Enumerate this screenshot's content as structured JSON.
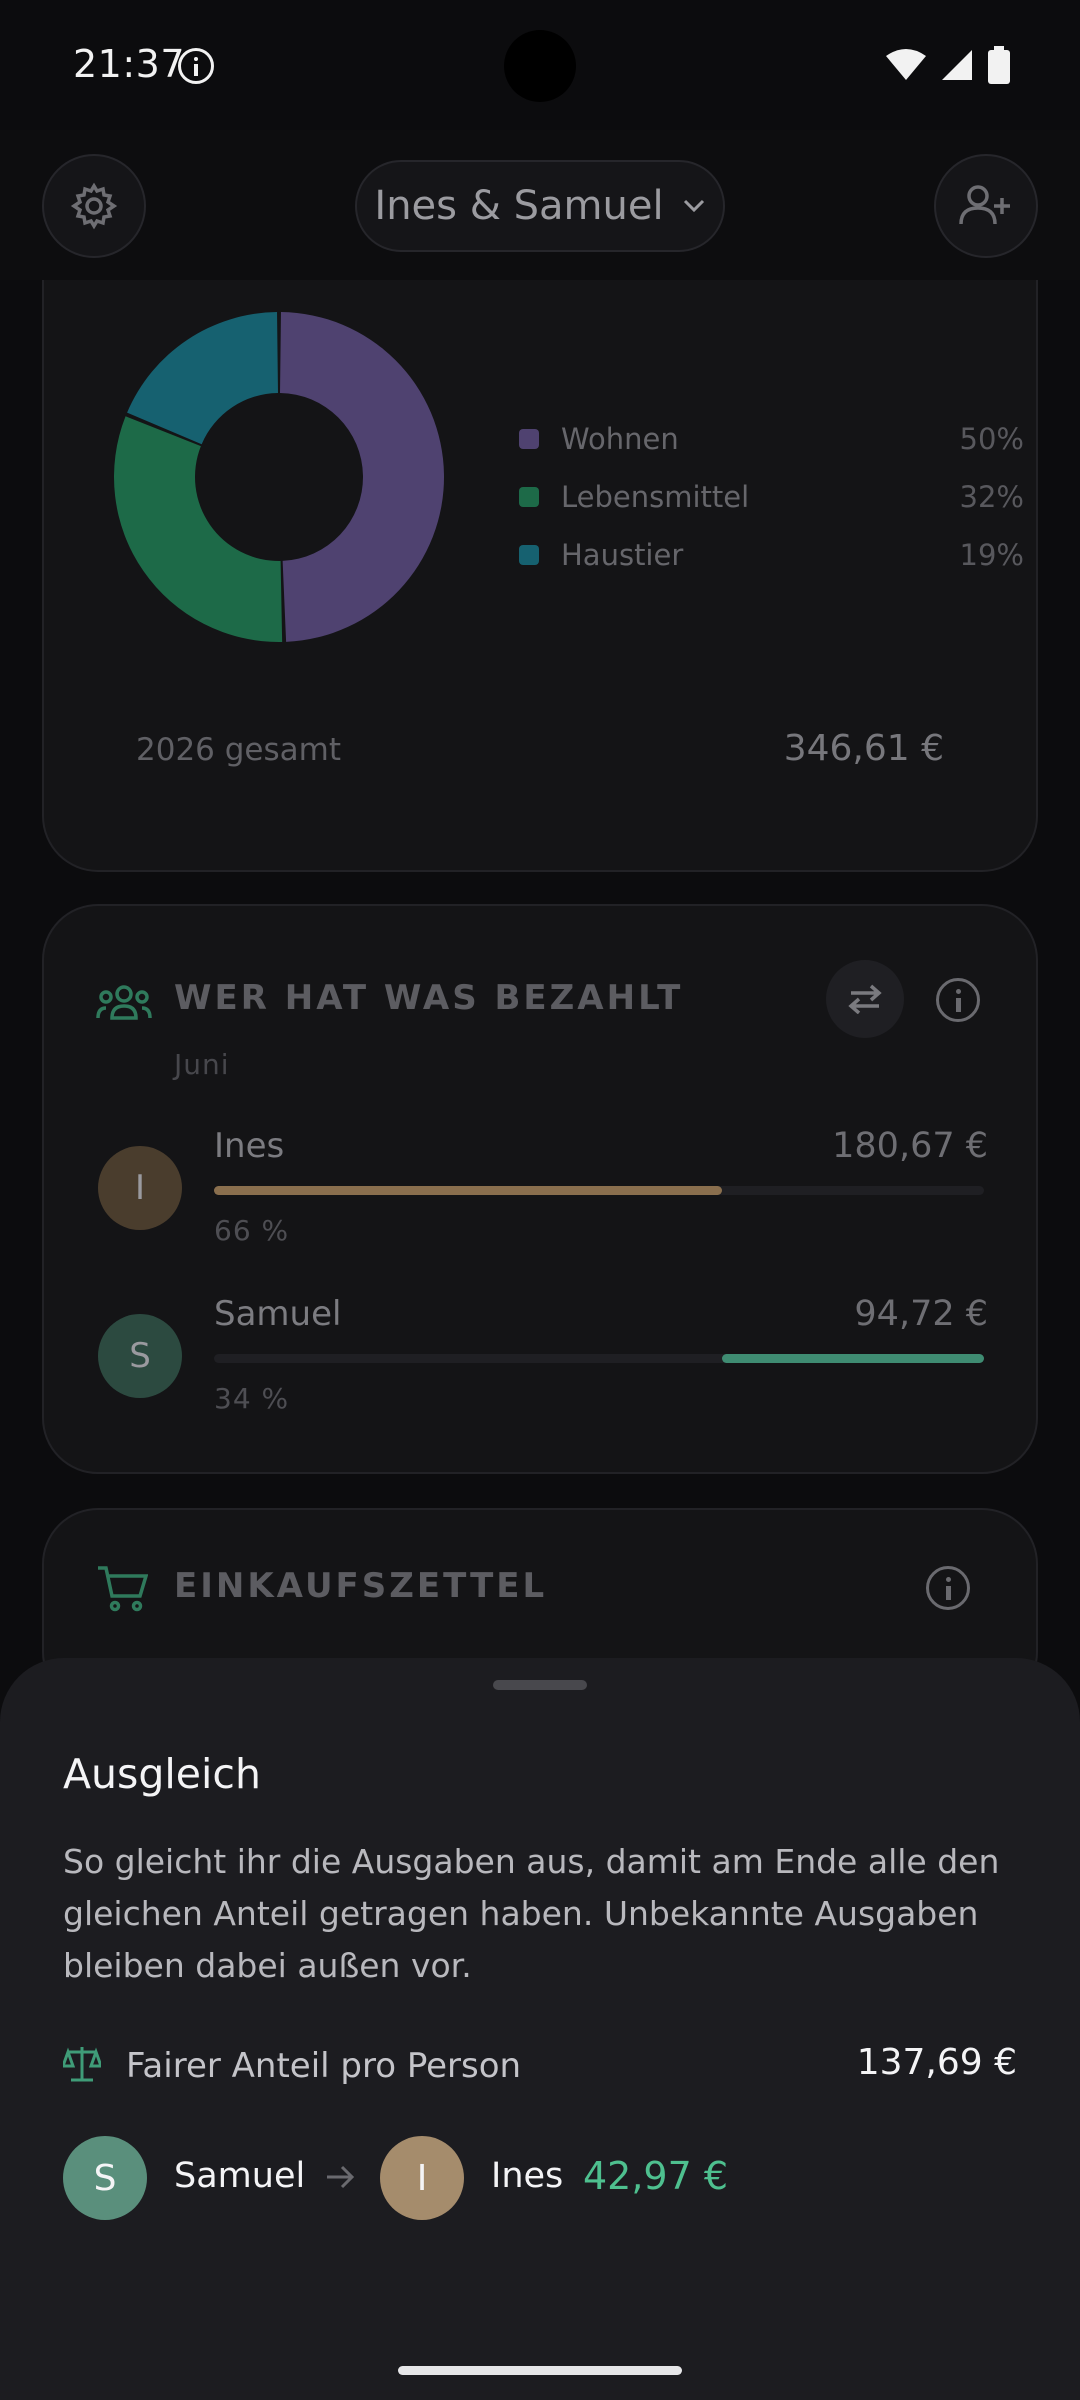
{
  "status_bar": {
    "time": "21:37"
  },
  "header": {
    "group_name": "Ines & Samuel"
  },
  "chart_card": {
    "total_label": "2026 gesamt",
    "total_value": "346,61 €"
  },
  "chart_data": {
    "type": "pie",
    "categories": [
      "Wohnen",
      "Lebensmittel",
      "Haustier"
    ],
    "values": [
      50,
      32,
      19
    ],
    "labels": [
      "50%",
      "32%",
      "19%"
    ],
    "colors": [
      "#4f4270",
      "#1d6a48",
      "#166170"
    ]
  },
  "paid_card": {
    "title": "WER HAT WAS BEZAHLT",
    "period": "Juni",
    "people": [
      {
        "initial": "I",
        "name": "Ines",
        "amount": "180,67 €",
        "percent_label": "66 %",
        "share": 0.66,
        "color": "#8a6f4e",
        "avatar_bg": "#4a3d2d"
      },
      {
        "initial": "S",
        "name": "Samuel",
        "amount": "94,72 €",
        "percent_label": "34 %",
        "share": 0.34,
        "color": "#3f8c72",
        "avatar_bg": "#2c4a40"
      }
    ]
  },
  "shopping_card": {
    "title": "EINKAUFSZETTEL"
  },
  "sheet": {
    "title": "Ausgleich",
    "description": "So gleicht ihr die Ausgaben aus, damit am Ende alle den gleichen Anteil getragen haben. Unbekannte Ausgaben bleiben dabei außen vor.",
    "fair_share_label": "Fairer Anteil pro Person",
    "fair_share_value": "137,69 €",
    "transfer": {
      "from_initial": "S",
      "from_name": "Samuel",
      "to_initial": "I",
      "to_name": "Ines",
      "amount": "42,97 €"
    }
  },
  "colors": {
    "accent_green": "#4ec08f",
    "sheet_bg": "#1c1c20"
  }
}
